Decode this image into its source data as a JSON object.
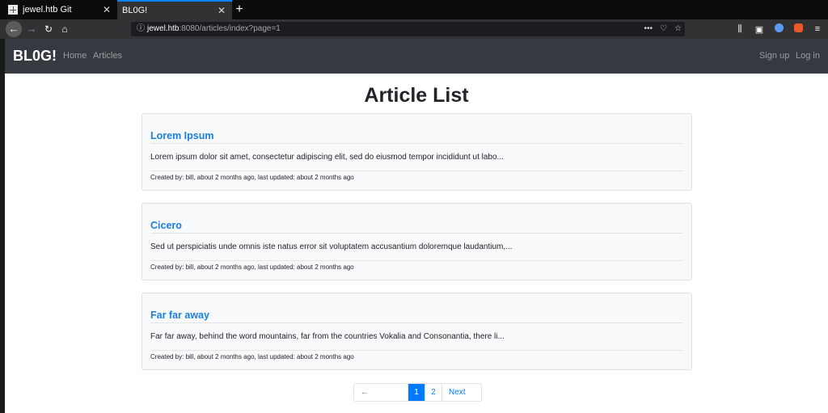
{
  "browser": {
    "tabs": [
      {
        "title": "jewel.htb Git",
        "close": "✕"
      },
      {
        "title": "BL0G!",
        "close": "✕"
      }
    ],
    "new_tab": "+",
    "url": {
      "host": "jewel.htb",
      "rest": ":8080/articles/index?page=1"
    },
    "url_actions": [
      "•••",
      "♡",
      "☆"
    ],
    "toolbar_icons": [
      "library-icon",
      "sidebar-icon",
      "account-icon",
      "extension-icon",
      "menu-icon"
    ]
  },
  "navbar": {
    "brand": "BL0G!",
    "links": [
      "Home",
      "Articles"
    ],
    "right_links": [
      "Sign up",
      "Log in"
    ]
  },
  "page": {
    "title": "Article List"
  },
  "articles": [
    {
      "title": "Lorem Ipsum",
      "excerpt": "Lorem ipsum dolor sit amet, consectetur adipiscing elit, sed do eiusmod tempor incididunt ut labo...",
      "meta": "Created by: bill, about 2 months ago, last updated: about 2 months ago"
    },
    {
      "title": "Cicero",
      "excerpt": "Sed ut perspiciatis unde omnis iste natus error sit voluptatem accusantium doloremque laudantium,...",
      "meta": "Created by: bill, about 2 months ago, last updated: about 2 months ago"
    },
    {
      "title": "Far far away",
      "excerpt": "Far far away, behind the word mountains, far from the countries Vokalia and Consonantia, there li...",
      "meta": "Created by: bill, about 2 months ago, last updated: about 2 months ago"
    }
  ],
  "pagination": {
    "previous": "← Previous",
    "pages": [
      "1",
      "2"
    ],
    "current": "1",
    "next": "Next →"
  },
  "colors": {
    "navbar_bg": "#343a40",
    "link": "#1a7fe1",
    "active_page": "#007bff"
  }
}
